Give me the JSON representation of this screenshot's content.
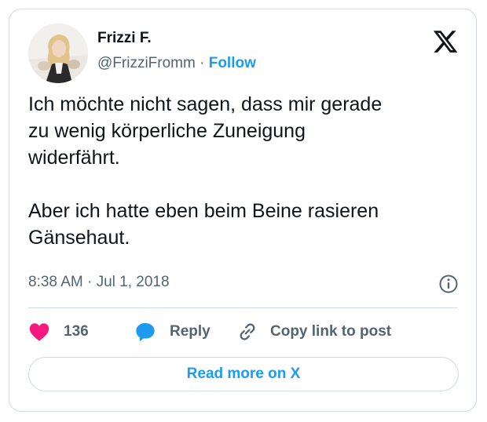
{
  "author": {
    "name": "Frizzi F.",
    "handle": "@FrizziFromm",
    "separator": "·",
    "follow_label": "Follow"
  },
  "tweet": {
    "paragraphs": [
      [
        "Ich möchte nicht sagen, dass mir gerade",
        "zu wenig körperliche Zuneigung",
        "widerfährt."
      ],
      [
        "Aber ich hatte eben beim Beine rasieren",
        "Gänsehaut."
      ]
    ],
    "timestamp": "8:38 AM · Jul 1, 2018"
  },
  "actions": {
    "like_count": "136",
    "reply_label": "Reply",
    "copy_link_label": "Copy link to post"
  },
  "read_more_label": "Read more on X",
  "colors": {
    "accent": "#1d9bf0",
    "like": "#f91880",
    "text": "#0f1419",
    "secondary_text": "#536471",
    "border": "#cfd9de"
  },
  "icons": [
    "x-logo-icon",
    "info-icon",
    "heart-icon",
    "reply-bubble-icon",
    "link-icon"
  ]
}
